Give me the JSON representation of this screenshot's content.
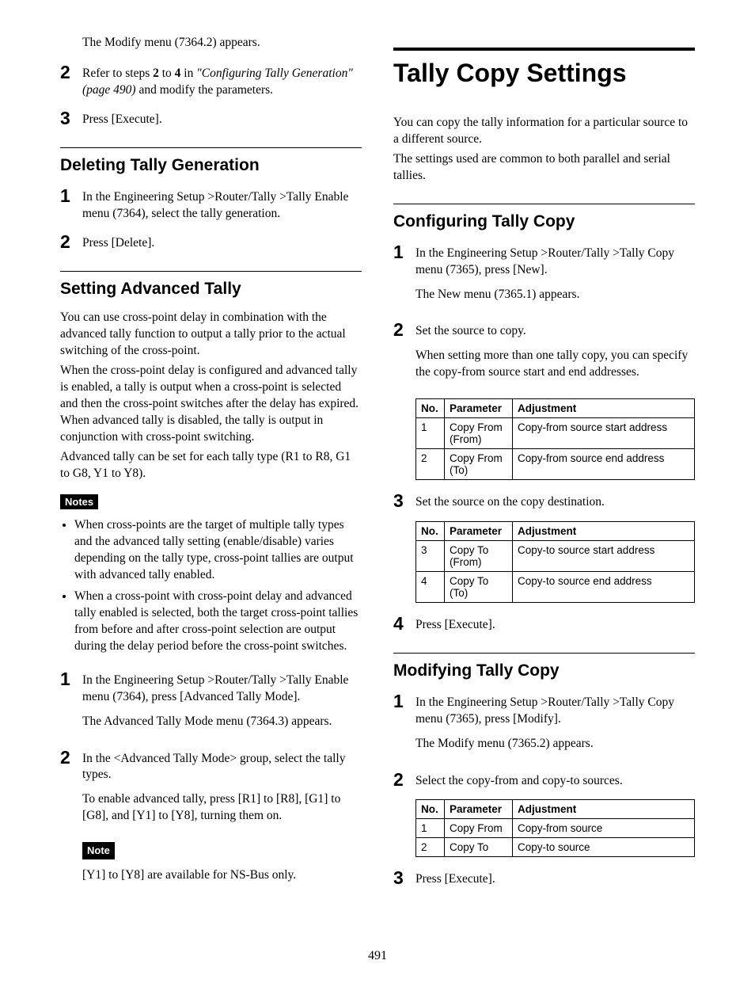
{
  "left": {
    "intro_steps": [
      {
        "num": "",
        "text": "The Modify menu (7364.2) appears."
      },
      {
        "num": "2",
        "text_a": "Refer to steps ",
        "bold1": "2",
        "text_b": " to ",
        "bold2": "4",
        "text_c": " in ",
        "italic": "\"Configuring Tally Generation\" (page 490)",
        "text_d": " and modify the parameters."
      },
      {
        "num": "3",
        "text": "Press [Execute]."
      }
    ],
    "del_heading": "Deleting Tally Generation",
    "del_steps": [
      {
        "num": "1",
        "text": "In the Engineering Setup >Router/Tally >Tally Enable menu (7364), select the tally generation."
      },
      {
        "num": "2",
        "text": "Press [Delete]."
      }
    ],
    "adv_heading": "Setting Advanced Tally",
    "adv_para1": "You can use cross-point delay in combination with the advanced tally function to output a tally prior to the actual switching of the cross-point.",
    "adv_para2": "When the cross-point delay is configured and advanced tally is enabled, a tally is output when a cross-point is selected and then the cross-point switches after the delay has expired. When advanced tally is disabled, the tally is output in conjunction with cross-point switching.",
    "adv_para3": "Advanced tally can be set for each tally type (R1 to R8, G1 to G8, Y1 to Y8).",
    "notes_label": "Notes",
    "adv_notes": [
      "When cross-points are the target of multiple tally types and the advanced tally setting (enable/disable) varies depending on the tally type, cross-point tallies are output with advanced tally enabled.",
      "When a cross-point with cross-point delay and advanced tally enabled is selected, both the target cross-point tallies from before and after cross-point selection are output during the delay period before the cross-point switches."
    ],
    "adv_steps": [
      {
        "num": "1",
        "p1": "In the Engineering Setup >Router/Tally >Tally Enable menu (7364), press [Advanced Tally Mode].",
        "p2": "The Advanced Tally Mode menu (7364.3) appears."
      },
      {
        "num": "2",
        "p1": "In the <Advanced Tally Mode> group, select the tally types.",
        "p2": "To enable advanced tally, press [R1] to [R8], [G1] to [G8], and [Y1] to [Y8], turning them on."
      }
    ],
    "note_label": "Note",
    "note_text": "[Y1] to [Y8] are available for NS-Bus only."
  },
  "right": {
    "title": "Tally Copy Settings",
    "intro1": "You can copy the tally information for a particular source to a different source.",
    "intro2": "The settings used are common to both parallel and serial tallies.",
    "cfg_heading": "Configuring Tally Copy",
    "cfg_step1_num": "1",
    "cfg_step1_p1": "In the Engineering Setup >Router/Tally >Tally Copy menu (7365), press [New].",
    "cfg_step1_p2": "The New menu (7365.1) appears.",
    "cfg_step2_num": "2",
    "cfg_step2_p1": "Set the source to copy.",
    "cfg_step2_p2": "When setting more than one tally copy, you can specify the copy-from source start and end addresses.",
    "table_headers": {
      "no": "No.",
      "param": "Parameter",
      "adj": "Adjustment"
    },
    "cfg_table1": [
      {
        "no": "1",
        "param": "Copy From (From)",
        "adj": "Copy-from source start address"
      },
      {
        "no": "2",
        "param": "Copy From (To)",
        "adj": "Copy-from source end address"
      }
    ],
    "cfg_step3_num": "3",
    "cfg_step3_p1": "Set the source on the copy destination.",
    "cfg_table2": [
      {
        "no": "3",
        "param": "Copy To (From)",
        "adj": "Copy-to source start address"
      },
      {
        "no": "4",
        "param": "Copy To (To)",
        "adj": "Copy-to source end address"
      }
    ],
    "cfg_step4_num": "4",
    "cfg_step4_p1": "Press [Execute].",
    "mod_heading": "Modifying Tally Copy",
    "mod_step1_num": "1",
    "mod_step1_p1": "In the Engineering Setup >Router/Tally >Tally Copy menu (7365), press [Modify].",
    "mod_step1_p2": "The Modify menu (7365.2) appears.",
    "mod_step2_num": "2",
    "mod_step2_p1": "Select the copy-from and copy-to sources.",
    "mod_table": [
      {
        "no": "1",
        "param": "Copy From",
        "adj": "Copy-from source"
      },
      {
        "no": "2",
        "param": "Copy To",
        "adj": "Copy-to source"
      }
    ],
    "mod_step3_num": "3",
    "mod_step3_p1": "Press [Execute]."
  },
  "page_number": "491"
}
